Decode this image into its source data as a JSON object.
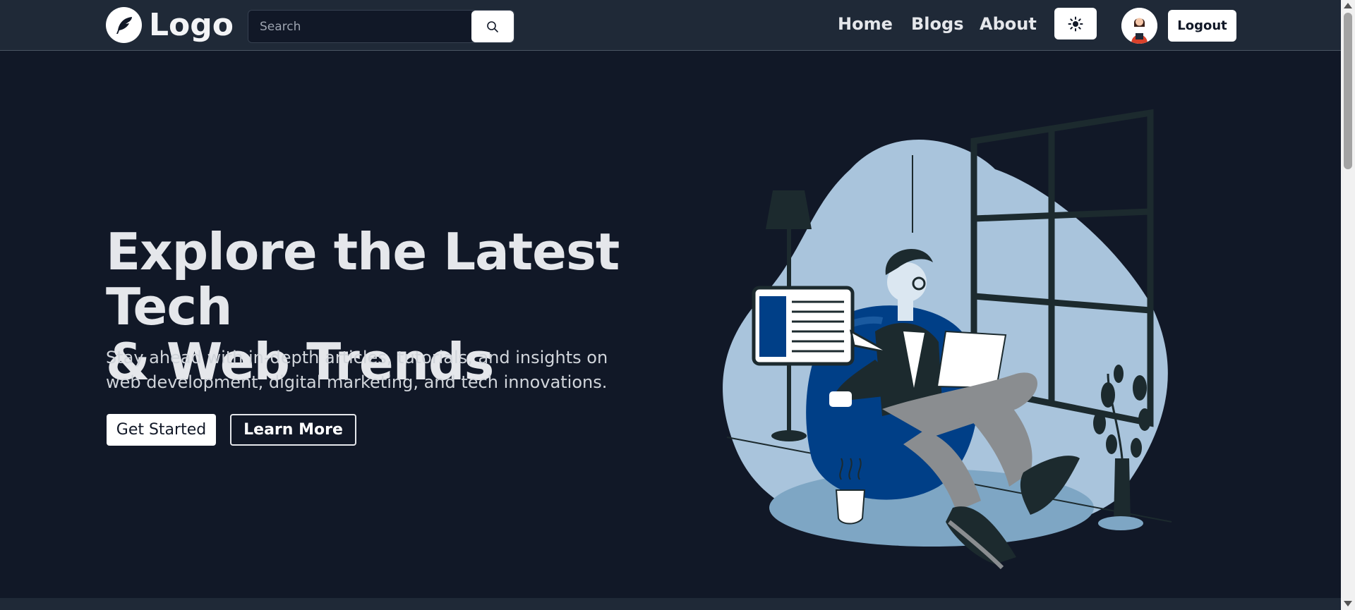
{
  "header": {
    "logo_text": "Logo",
    "logo_icon": "feather-icon",
    "search": {
      "placeholder": "Search",
      "button_icon": "search-icon"
    },
    "nav": [
      {
        "label": "Home"
      },
      {
        "label": "Blogs"
      },
      {
        "label": "About"
      }
    ],
    "theme_toggle_icon": "sun-icon",
    "avatar_icon": "user-avatar",
    "logout_label": "Logout"
  },
  "hero": {
    "title_line1": "Explore the Latest Tech",
    "title_line2": "& Web Trends",
    "subtitle": "Stay ahead with in-depth articles, tutorials, and insights on web development, digital marketing, and tech innovations.",
    "primary_button": "Get Started",
    "secondary_button": "Learn More"
  },
  "colors": {
    "background": "#111827",
    "header": "#1f2937",
    "text": "#e5e7eb",
    "illustration_blue": "#003f87",
    "illustration_light": "#a9c4dc"
  }
}
